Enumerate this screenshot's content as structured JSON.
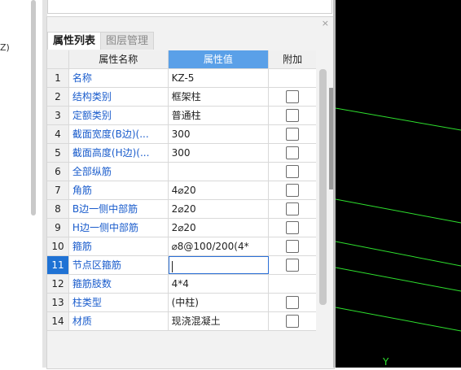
{
  "left_pane": {
    "text": "Z)"
  },
  "panel": {
    "close_glyph": "×",
    "tabs": [
      {
        "label": "属性列表",
        "active": true
      },
      {
        "label": "图层管理",
        "active": false
      }
    ],
    "columns": {
      "name": "属性名称",
      "value": "属性值",
      "add": "附加"
    },
    "rows": [
      {
        "num": "1",
        "name": "名称",
        "value": "KZ-5",
        "checkbox": false
      },
      {
        "num": "2",
        "name": "结构类别",
        "value": "框架柱",
        "checkbox": true
      },
      {
        "num": "3",
        "name": "定额类别",
        "value": "普通柱",
        "checkbox": true
      },
      {
        "num": "4",
        "name": "截面宽度(B边)(...",
        "value": "300",
        "checkbox": true
      },
      {
        "num": "5",
        "name": "截面高度(H边)(...",
        "value": "300",
        "checkbox": true
      },
      {
        "num": "6",
        "name": "全部纵筋",
        "value": "",
        "checkbox": true
      },
      {
        "num": "7",
        "name": "角筋",
        "value": "4⌀20",
        "checkbox": true
      },
      {
        "num": "8",
        "name": "B边一侧中部筋",
        "value": "2⌀20",
        "checkbox": true
      },
      {
        "num": "9",
        "name": "H边一侧中部筋",
        "value": "2⌀20",
        "checkbox": true
      },
      {
        "num": "10",
        "name": "箍筋",
        "value": "⌀8@100/200(4*",
        "checkbox": true
      },
      {
        "num": "11",
        "name": "节点区箍筋",
        "value": "",
        "checkbox": true,
        "selected": true
      },
      {
        "num": "12",
        "name": "箍筋肢数",
        "value": "4*4",
        "checkbox": false
      },
      {
        "num": "13",
        "name": "柱类型",
        "value": "(中柱)",
        "checkbox": true
      },
      {
        "num": "14",
        "name": "材质",
        "value": "现浇混凝土",
        "checkbox": true
      }
    ]
  },
  "cad": {
    "axis_label": "Y",
    "line_color": "#2ee02e",
    "background": "#000000"
  },
  "colors": {
    "accent": "#5aa0e8",
    "selected_row": "#1f72d4",
    "link_text": "#1a5ccc"
  }
}
